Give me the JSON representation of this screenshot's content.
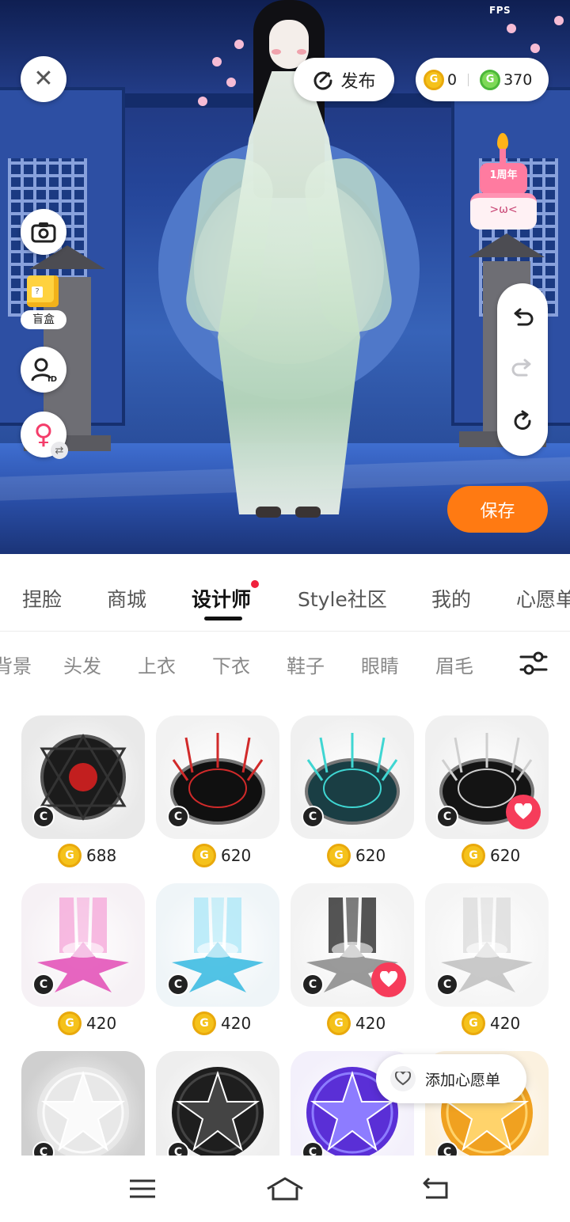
{
  "status_bar": {
    "fps": "FPS"
  },
  "header": {
    "publish_label": "发布",
    "currency": {
      "coins": "0",
      "gems": "370",
      "coin_symbol": "G",
      "gem_symbol": "G"
    }
  },
  "side_tools": {
    "blindbox_label": "盲盒",
    "blindbox_symbol": "?",
    "profile_badge": "ID",
    "gender_symbol": "♀"
  },
  "event": {
    "cake_top": "1周年",
    "cake_face": ">ω<"
  },
  "save_label": "保存",
  "main_tabs": [
    "捏脸",
    "商城",
    "设计师",
    "Style社区",
    "我的",
    "心愿单"
  ],
  "active_main_tab": "设计师",
  "sub_tabs": [
    "背景",
    "头发",
    "上衣",
    "下衣",
    "鞋子",
    "眼睛",
    "眉毛"
  ],
  "items": [
    {
      "price": "688",
      "badge": "C",
      "favorited": false,
      "theme": "dark-red-circle"
    },
    {
      "price": "620",
      "badge": "C",
      "favorited": false,
      "theme": "red-needles"
    },
    {
      "price": "620",
      "badge": "C",
      "favorited": false,
      "theme": "teal-circle"
    },
    {
      "price": "620",
      "badge": "C",
      "favorited": true,
      "theme": "black-circle"
    },
    {
      "price": "420",
      "badge": "C",
      "favorited": false,
      "theme": "pink-star"
    },
    {
      "price": "420",
      "badge": "C",
      "favorited": false,
      "theme": "cyan-star"
    },
    {
      "price": "420",
      "badge": "C",
      "favorited": true,
      "theme": "black-star"
    },
    {
      "price": "420",
      "badge": "C",
      "favorited": false,
      "theme": "silver-star"
    },
    {
      "price": "",
      "badge": "C",
      "favorited": false,
      "theme": "grey-star-circle"
    },
    {
      "price": "",
      "badge": "C",
      "favorited": false,
      "theme": "black-star-circle"
    },
    {
      "price": "",
      "badge": "C",
      "favorited": false,
      "theme": "purple-star-circle"
    },
    {
      "price": "",
      "badge": "C",
      "favorited": false,
      "theme": "gold-star-circle"
    }
  ],
  "wishlist_popup": "添加心愿单",
  "colors": {
    "accent_orange": "#ff7a12",
    "fav_red": "#f63c5a",
    "coin_gold": "#f5c21b",
    "gem_green": "#7ed957"
  }
}
